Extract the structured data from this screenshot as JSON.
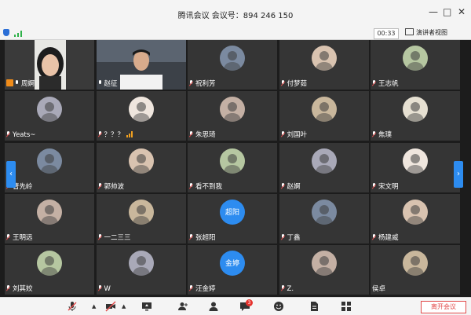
{
  "window": {
    "title": "腾讯会议 会议号：894 246 150",
    "controls": [
      "—",
      "□",
      "✕"
    ]
  },
  "header": {
    "timer": "00:33",
    "view_button_label": "演讲者视图"
  },
  "participants": [
    {
      "name": "周婀",
      "host": true,
      "mic": "on",
      "style": "photo-woman"
    },
    {
      "name": "赵征",
      "mic": "on",
      "style": "photo-man"
    },
    {
      "name": "祝利芳",
      "mic": "off",
      "style": "avatar"
    },
    {
      "name": "付梦茹",
      "mic": "off",
      "style": "avatar"
    },
    {
      "name": "王志帆",
      "mic": "off",
      "style": "avatar"
    },
    {
      "name": "Yeats~",
      "mic": "off",
      "style": "avatar"
    },
    {
      "name": "？？？",
      "mic": "off",
      "style": "avatar",
      "speaking": true
    },
    {
      "name": "朱思琦",
      "mic": "off",
      "style": "avatar"
    },
    {
      "name": "刘国叶",
      "mic": "off",
      "style": "avatar"
    },
    {
      "name": "焦璞",
      "mic": "off",
      "style": "avatar"
    },
    {
      "name": "曹先岭",
      "mic": "off",
      "style": "avatar"
    },
    {
      "name": "郭帅波",
      "mic": "off",
      "style": "avatar"
    },
    {
      "name": "看不到我",
      "mic": "off",
      "style": "avatar"
    },
    {
      "name": "赵婀",
      "mic": "off",
      "style": "avatar"
    },
    {
      "name": "宋文明",
      "mic": "off",
      "style": "avatar"
    },
    {
      "name": "王明远",
      "mic": "off",
      "style": "avatar"
    },
    {
      "name": "一二三三",
      "mic": "off",
      "style": "avatar"
    },
    {
      "name": "张超阳",
      "mic": "off",
      "style": "text-avatar",
      "avatar_text": "超阳"
    },
    {
      "name": "丁鑫",
      "mic": "off",
      "style": "avatar"
    },
    {
      "name": "杨建威",
      "mic": "off",
      "style": "avatar"
    },
    {
      "name": "刘其姣",
      "mic": "off",
      "style": "avatar"
    },
    {
      "name": "W",
      "mic": "off",
      "style": "avatar"
    },
    {
      "name": "汪金婷",
      "mic": "off",
      "style": "text-avatar",
      "avatar_text": "金婷"
    },
    {
      "name": "Z.",
      "mic": "off",
      "style": "avatar"
    },
    {
      "name": "侯卓",
      "mic": "none",
      "style": "avatar"
    }
  ],
  "navigation": {
    "prev": "‹",
    "next": "›"
  },
  "toolbar": {
    "chat_badge": "3",
    "leave_label": "离开会议",
    "icons": [
      "mic-muted-icon",
      "camera-off-icon",
      "screen-share-icon",
      "invite-icon",
      "members-icon",
      "chat-icon",
      "reaction-icon",
      "document-icon",
      "apps-icon"
    ]
  },
  "colors": {
    "accent": "#2d8cf0",
    "active_border": "#3aa64f",
    "tile": "#353535",
    "danger": "#e24b4b",
    "host_badge": "#f08c1a"
  }
}
